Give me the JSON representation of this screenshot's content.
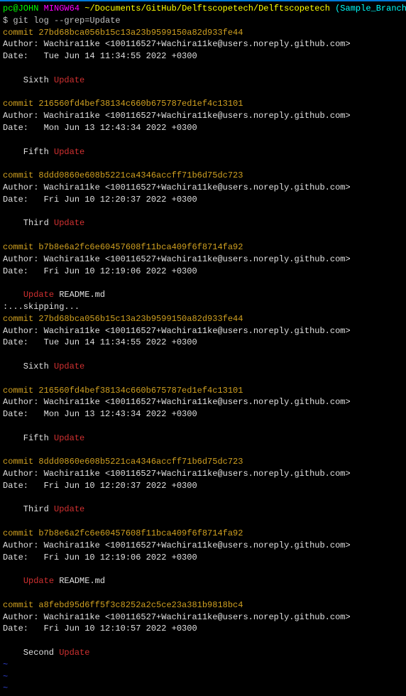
{
  "prompt": {
    "user": "pc@JOHN",
    "env": "MINGW64",
    "path": "~/Documents/GitHub/Delftscopetech/Delftscopetech",
    "branch": "(Sample_Branch)",
    "dollar": "$",
    "command": "git log --grep=Update"
  },
  "commits": [
    {
      "hash": "commit 27bd68bca056b15c13a23b9599150a82d933fe44",
      "author": "Author: Wachira11ke <100116527+Wachira11ke@users.noreply.github.com>",
      "date": "Date:   Tue Jun 14 11:34:55 2022 +0300",
      "msg_pre": "    Sixth ",
      "msg_red": "Update",
      "msg_post": ""
    },
    {
      "hash": "commit 216560fd4bef38134c660b675787ed1ef4c13101",
      "author": "Author: Wachira11ke <100116527+Wachira11ke@users.noreply.github.com>",
      "date": "Date:   Mon Jun 13 12:43:34 2022 +0300",
      "msg_pre": "    Fifth ",
      "msg_red": "Update",
      "msg_post": ""
    },
    {
      "hash": "commit 8ddd0860e608b5221ca4346accff71b6d75dc723",
      "author": "Author: Wachira11ke <100116527+Wachira11ke@users.noreply.github.com>",
      "date": "Date:   Fri Jun 10 12:20:37 2022 +0300",
      "msg_pre": "    Third ",
      "msg_red": "Update",
      "msg_post": ""
    },
    {
      "hash": "commit b7b8e6a2fc6e60457608f11bca409f6f8714fa92",
      "author": "Author: Wachira11ke <100116527+Wachira11ke@users.noreply.github.com>",
      "date": "Date:   Fri Jun 10 12:19:06 2022 +0300",
      "msg_pre": "    ",
      "msg_red": "Update",
      "msg_post": " README.md"
    }
  ],
  "skip_line": ":...skipping...",
  "commits2": [
    {
      "hash": "commit 27bd68bca056b15c13a23b9599150a82d933fe44",
      "author": "Author: Wachira11ke <100116527+Wachira11ke@users.noreply.github.com>",
      "date": "Date:   Tue Jun 14 11:34:55 2022 +0300",
      "msg_pre": "    Sixth ",
      "msg_red": "Update",
      "msg_post": ""
    },
    {
      "hash": "commit 216560fd4bef38134c660b675787ed1ef4c13101",
      "author": "Author: Wachira11ke <100116527+Wachira11ke@users.noreply.github.com>",
      "date": "Date:   Mon Jun 13 12:43:34 2022 +0300",
      "msg_pre": "    Fifth ",
      "msg_red": "Update",
      "msg_post": ""
    },
    {
      "hash": "commit 8ddd0860e608b5221ca4346accff71b6d75dc723",
      "author": "Author: Wachira11ke <100116527+Wachira11ke@users.noreply.github.com>",
      "date": "Date:   Fri Jun 10 12:20:37 2022 +0300",
      "msg_pre": "    Third ",
      "msg_red": "Update",
      "msg_post": ""
    },
    {
      "hash": "commit b7b8e6a2fc6e60457608f11bca409f6f8714fa92",
      "author": "Author: Wachira11ke <100116527+Wachira11ke@users.noreply.github.com>",
      "date": "Date:   Fri Jun 10 12:19:06 2022 +0300",
      "msg_pre": "    ",
      "msg_red": "Update",
      "msg_post": " README.md"
    },
    {
      "hash": "commit a8febd95d6ff5f3c8252a2c5ce23a381b9818bc4",
      "author": "Author: Wachira11ke <100116527+Wachira11ke@users.noreply.github.com>",
      "date": "Date:   Fri Jun 10 12:10:57 2022 +0300",
      "msg_pre": "    Second ",
      "msg_red": "Update",
      "msg_post": ""
    }
  ],
  "tilde": "~"
}
